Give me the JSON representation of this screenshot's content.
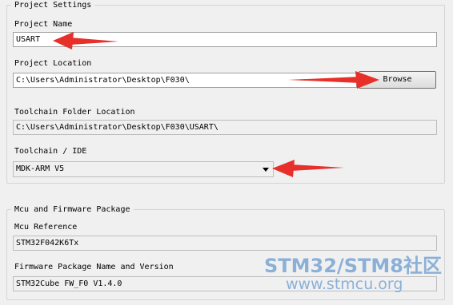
{
  "project_settings": {
    "title": "Project Settings",
    "name_label": "Project Name",
    "name_value": "USART",
    "location_label": "Project Location",
    "location_value": "C:\\Users\\Administrator\\Desktop\\F030\\",
    "browse_label": "Browse",
    "toolchain_folder_label": "Toolchain Folder Location",
    "toolchain_folder_value": "C:\\Users\\Administrator\\Desktop\\F030\\USART\\",
    "toolchain_ide_label": "Toolchain / IDE",
    "toolchain_ide_value": "MDK-ARM V5"
  },
  "mcu_package": {
    "title": "Mcu and Firmware Package",
    "mcu_ref_label": "Mcu Reference",
    "mcu_ref_value": "STM32F042K6Tx",
    "firmware_label": "Firmware Package Name and Version",
    "firmware_value": "STM32Cube FW_F0 V1.4.0"
  },
  "watermark": {
    "line1": "STM32/STM8社区",
    "line2": "www.stmcu.org"
  },
  "colors": {
    "annotation_arrow": "#e8302a",
    "watermark": "#7aa6d4"
  }
}
